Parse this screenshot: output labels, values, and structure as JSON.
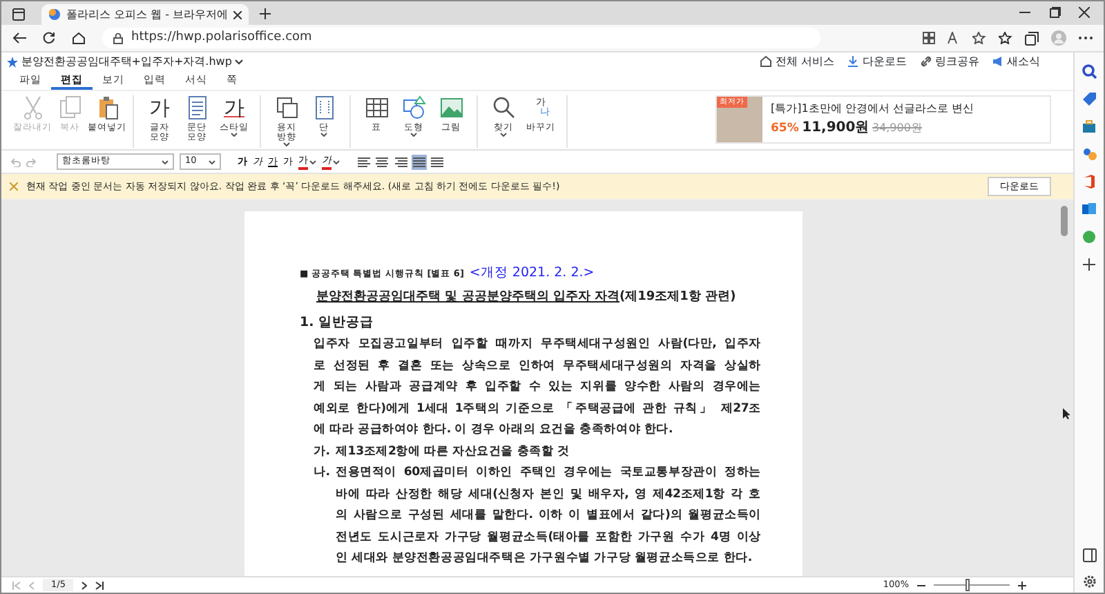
{
  "browser": {
    "tab": {
      "title": "폴라리스 오피스 웹 - 브라우저에",
      "selected": true
    },
    "url": "https://hwp.polarisoffice.com"
  },
  "app": {
    "file_name": "분양전환공공임대주택+입주자+자격.hwp",
    "header_links": [
      {
        "kind": "home",
        "label": "전체 서비스"
      },
      {
        "kind": "download",
        "label": "다운로드"
      },
      {
        "kind": "link",
        "label": "링크공유"
      },
      {
        "kind": "news",
        "label": "새소식"
      }
    ],
    "menu_tabs": [
      {
        "label": "파일",
        "selected": false
      },
      {
        "label": "편집",
        "selected": true
      },
      {
        "label": "보기",
        "selected": false
      },
      {
        "label": "입력",
        "selected": false
      },
      {
        "label": "서식",
        "selected": false
      },
      {
        "label": "쪽",
        "selected": false
      }
    ],
    "ribbon": [
      [
        {
          "kind": "cut",
          "label": "잘라내기",
          "disabled": true,
          "caret": false
        },
        {
          "kind": "copy",
          "label": "복사",
          "disabled": true,
          "caret": false
        },
        {
          "kind": "paste",
          "label": "붙여넣기",
          "disabled": false,
          "caret": false
        }
      ],
      [
        {
          "kind": "char",
          "label": "글자\n모양",
          "glyph": "가",
          "disabled": false,
          "caret": false
        },
        {
          "kind": "para",
          "label": "문단\n모양",
          "disabled": false,
          "caret": false
        },
        {
          "kind": "style",
          "label": "스타일",
          "glyph": "가",
          "disabled": false,
          "caret": true
        }
      ],
      [
        {
          "kind": "orient",
          "label": "용지\n방향",
          "disabled": false,
          "caret": true
        },
        {
          "kind": "cols",
          "label": "단",
          "disabled": false,
          "caret": true
        }
      ],
      [
        {
          "kind": "table",
          "label": "표",
          "disabled": false,
          "caret": false
        },
        {
          "kind": "shape",
          "label": "도형",
          "disabled": false,
          "caret": true
        },
        {
          "kind": "image",
          "label": "그림",
          "disabled": false,
          "caret": false
        }
      ],
      [
        {
          "kind": "find",
          "label": "찾기",
          "disabled": false,
          "caret": true
        },
        {
          "kind": "replace",
          "label": "바꾸기",
          "glyph": "가",
          "glyph2": "나",
          "disabled": false,
          "caret": false
        }
      ]
    ],
    "ad": {
      "badge": "최저가",
      "title": "[특가]1초만에 안경에서 선글라스로 변신",
      "discount": "65%",
      "price": "11,900원",
      "original_price": "34,900원"
    },
    "format_bar": {
      "font": "함초롬바탕",
      "size": "10",
      "styles": [
        {
          "kind": "bold",
          "label": "가",
          "caret": false
        },
        {
          "kind": "italic",
          "label": "가",
          "caret": false
        },
        {
          "kind": "underline",
          "label": "가",
          "caret": false
        },
        {
          "kind": "plain",
          "label": "가",
          "caret": false
        },
        {
          "kind": "color",
          "label": "가",
          "caret": true
        },
        {
          "kind": "highlight",
          "label": "가",
          "caret": true
        }
      ],
      "alignments": [
        {
          "kind": "left",
          "selected": false
        },
        {
          "kind": "center",
          "selected": false
        },
        {
          "kind": "right",
          "selected": false
        },
        {
          "kind": "justify",
          "selected": true
        },
        {
          "kind": "distribute",
          "selected": false
        }
      ]
    },
    "notice": {
      "text": "현재 작업 중인 문서는 자동 저장되지 않아요. 작업 완료 후 ‘꼭’ 다운로드 해주세요. (새로 고침 하기 전에도 다운로드 필수!)",
      "button": "다운로드"
    },
    "document": {
      "law_ref": "■ 공공주택 특별법 시행규칙 [별표 6]",
      "revision": "<개정 2021. 2. 2.>",
      "title": "분양전환공공임대주택 및 공공분양주택의 입주자 자격",
      "title_ref": "(제19조제1항 관련)",
      "heading": "1. 일반공급",
      "body": [
        "입주자 모집공고일부터 입주할 때까지 무주택세대구성원인 사람(다만, 입주자",
        "로 선정된 후 결혼 또는 상속으로 인하여 무주택세대구성원의 자격을 상실하",
        "게 되는 사람과 공급계약 후 입주할 수 있는 지위를 양수한 사람의 경우에는",
        "예외로 한다)에게 1세대 1주택의 기준으로 「주택공급에 관한 규칙」 제27조",
        "에 따라 공급하여야 한다. 이 경우 아래의 요건을 충족하여야 한다."
      ],
      "items": [
        {
          "marker": "가.",
          "lines": [
            "제13조제2항에 따른 자산요건을 충족할 것"
          ]
        },
        {
          "marker": "나.",
          "lines": [
            "전용면적이 60제곱미터 이하인 주택인 경우에는 국토교통부장관이 정하는",
            "바에 따라 산정한 해당 세대(신청자 본인 및 배우자, 영 제42조제1항 각 호",
            "의 사람으로 구성된 세대를 말한다. 이하 이 별표에서 같다)의 월평균소득이",
            "전년도 도시근로자 가구당 월평균소득(태아를 포함한 가구원 수가 4명 이상",
            "인 세대와 분양전환공공임대주택은 가구원수별 가구당 월평균소득으로 한다."
          ]
        }
      ]
    },
    "status": {
      "page": "1/5",
      "zoom": "100%",
      "zoom_slider": {
        "level": 0.45
      }
    }
  }
}
